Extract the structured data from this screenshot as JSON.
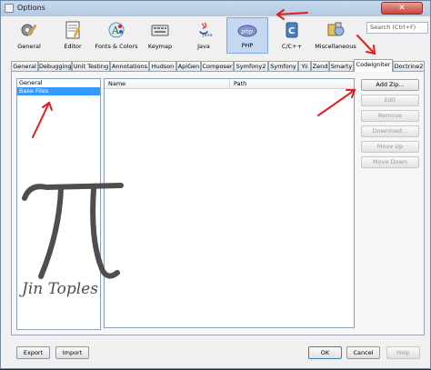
{
  "window": {
    "title": "Options",
    "close_glyph": "✕"
  },
  "search": {
    "placeholder": "Search (Ctrl+F)"
  },
  "categories": [
    {
      "label": "General",
      "icon": "gear-icon"
    },
    {
      "label": "Editor",
      "icon": "editor-icon"
    },
    {
      "label": "Fonts & Colors",
      "icon": "fonts-colors-icon"
    },
    {
      "label": "Keymap",
      "icon": "keymap-icon"
    },
    {
      "label": "Java",
      "icon": "java-icon"
    },
    {
      "label": "PHP",
      "icon": "php-icon",
      "selected": true
    },
    {
      "label": "C/C++",
      "icon": "cpp-icon"
    },
    {
      "label": "Miscellaneous",
      "icon": "miscellaneous-icon"
    }
  ],
  "tabs": [
    "General",
    "Debugging",
    "Unit Testing",
    "Annotations",
    "Hudson",
    "ApiGen",
    "Composer",
    "Symfony2",
    "Symfony",
    "Yii",
    "Zend",
    "Smarty",
    "CodeIgniter",
    "Doctrine2"
  ],
  "active_tab": "CodeIgniter",
  "nav_items": [
    {
      "label": "General",
      "selected": false
    },
    {
      "label": "Base Files",
      "selected": true
    }
  ],
  "table": {
    "columns": [
      "Name",
      "Path"
    ],
    "rows": []
  },
  "side_buttons": [
    {
      "label": "Add Zip...",
      "enabled": true
    },
    {
      "label": "Edit",
      "enabled": false
    },
    {
      "label": "Remove",
      "enabled": false
    },
    {
      "label": "Download...",
      "enabled": false
    },
    {
      "label": "Move Up",
      "enabled": false
    },
    {
      "label": "Move Down",
      "enabled": false
    }
  ],
  "footer": {
    "export": "Export",
    "import": "Import",
    "ok": "OK",
    "cancel": "Cancel",
    "help": "Help"
  },
  "watermark": {
    "symbol": "π",
    "text": "Jin Toples"
  },
  "colors": {
    "selection": "#3399ff",
    "annotation_arrows": "#e02020",
    "selected_category_bg": "#c5d8f2"
  }
}
